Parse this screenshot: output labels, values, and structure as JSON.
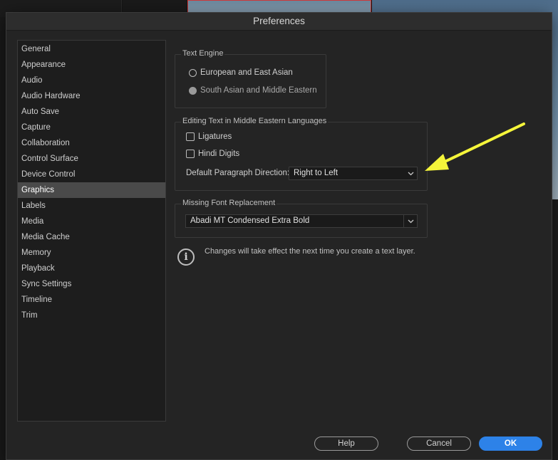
{
  "window": {
    "title": "Preferences"
  },
  "sidebar": {
    "items": [
      {
        "label": "General"
      },
      {
        "label": "Appearance"
      },
      {
        "label": "Audio"
      },
      {
        "label": "Audio Hardware"
      },
      {
        "label": "Auto Save"
      },
      {
        "label": "Capture"
      },
      {
        "label": "Collaboration"
      },
      {
        "label": "Control Surface"
      },
      {
        "label": "Device Control"
      },
      {
        "label": "Graphics",
        "selected": true
      },
      {
        "label": "Labels"
      },
      {
        "label": "Media"
      },
      {
        "label": "Media Cache"
      },
      {
        "label": "Memory"
      },
      {
        "label": "Playback"
      },
      {
        "label": "Sync Settings"
      },
      {
        "label": "Timeline"
      },
      {
        "label": "Trim"
      }
    ]
  },
  "text_engine": {
    "label": "Text Engine",
    "options": [
      {
        "label": "European and East Asian",
        "checked": false
      },
      {
        "label": "South Asian and Middle Eastern",
        "checked": true
      }
    ]
  },
  "middle_eastern": {
    "label": "Editing Text in Middle Eastern Languages",
    "ligatures": {
      "label": "Ligatures",
      "checked": false
    },
    "hindi_digits": {
      "label": "Hindi Digits",
      "checked": false
    },
    "direction_label": "Default Paragraph Direction:",
    "direction_value": "Right to Left"
  },
  "missing_font": {
    "label": "Missing Font Replacement",
    "value": "Abadi MT Condensed Extra Bold"
  },
  "info": {
    "text": "Changes will take effect the next time you create a text layer.",
    "icon": "info-icon"
  },
  "buttons": {
    "help": "Help",
    "cancel": "Cancel",
    "ok": "OK"
  },
  "colors": {
    "accent": "#2d82e8",
    "annotation_arrow": "#f5f53a",
    "selected_bg": "#4a4a4a"
  }
}
